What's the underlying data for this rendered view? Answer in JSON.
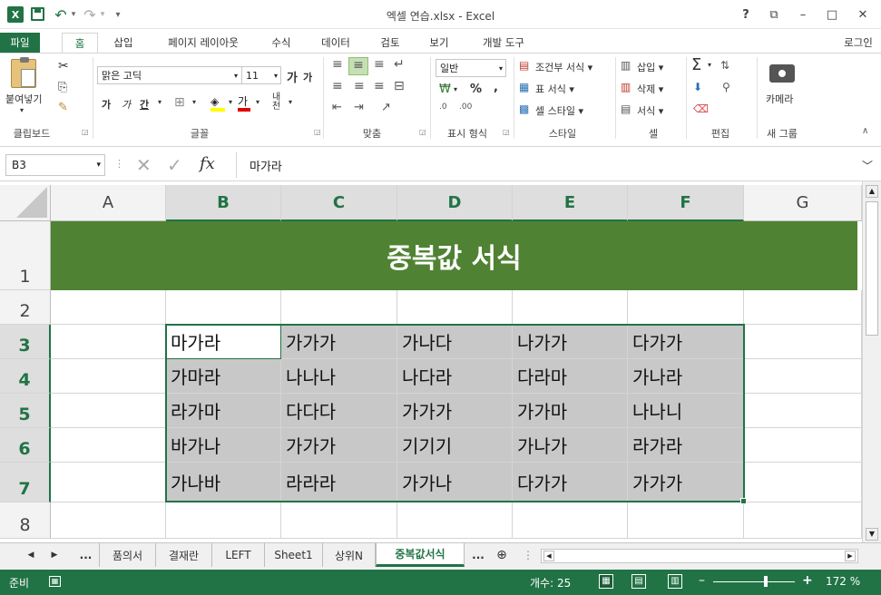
{
  "window": {
    "title": "엑셀 연습.xlsx - Excel",
    "help": "?",
    "minimize": "–",
    "maximize": "□",
    "close": "✕",
    "ribbon_display": "⧉"
  },
  "qat": {
    "undo": "↶",
    "redo": "↷",
    "customize": "▾"
  },
  "tabs": [
    {
      "label": "파일"
    },
    {
      "label": "홈"
    },
    {
      "label": "삽입"
    },
    {
      "label": "페이지 레이아웃"
    },
    {
      "label": "수식"
    },
    {
      "label": "데이터"
    },
    {
      "label": "검토"
    },
    {
      "label": "보기"
    },
    {
      "label": "개발 도구"
    }
  ],
  "signin": "로그인",
  "ribbon": {
    "clipboard": {
      "paste": "붙여넣기",
      "label": "클립보드"
    },
    "font": {
      "name": "맑은 고딕",
      "size": "11",
      "grow": "가",
      "shrink": "가",
      "bold": "가",
      "italic": "가",
      "underline": "간",
      "color_letter": "가",
      "phonetic": "내천",
      "label": "글꼴"
    },
    "align": {
      "label": "맞춤"
    },
    "number": {
      "format": "일반",
      "percent": "%",
      "comma": ",",
      "label": "표시 형식"
    },
    "styles": {
      "cond": "조건부 서식",
      "table": "표 서식",
      "cell": "셀 스타일",
      "label": "스타일"
    },
    "cells": {
      "insert": "삽입",
      "delete": "삭제",
      "format": "서식",
      "label": "셀"
    },
    "edit": {
      "sum": "Σ",
      "label": "편집"
    },
    "camera": {
      "button": "카메라",
      "label": "새 그룹"
    }
  },
  "formula_bar": {
    "name_box": "B3",
    "fx": "fx",
    "value": "마가라"
  },
  "columns": [
    "A",
    "B",
    "C",
    "D",
    "E",
    "F",
    "G"
  ],
  "rows": [
    "1",
    "2",
    "3",
    "4",
    "5",
    "6",
    "7",
    "8"
  ],
  "title_banner": "중복값 서식",
  "table": [
    [
      "마가라",
      "가가가",
      "가나다",
      "나가가",
      "다가가"
    ],
    [
      "가마라",
      "나나나",
      "나다라",
      "다라마",
      "가나라"
    ],
    [
      "라가마",
      "다다다",
      "가가가",
      "가가마",
      "나나니"
    ],
    [
      "바가나",
      "가가가",
      "기기기",
      "가나가",
      "라가라"
    ],
    [
      "가나바",
      "라라라",
      "가가나",
      "다가가",
      "가가가"
    ]
  ],
  "sheets": [
    {
      "label": "..."
    },
    {
      "label": "품의서"
    },
    {
      "label": "결재란"
    },
    {
      "label": "LEFT"
    },
    {
      "label": "Sheet1"
    },
    {
      "label": "상위N"
    },
    {
      "label": "중복값서식"
    },
    {
      "label": "..."
    }
  ],
  "status": {
    "ready": "준비",
    "count": "개수: 25",
    "zoom": "172 %"
  },
  "colors": {
    "accent": "#217346",
    "banner": "#4f8232",
    "highlight": "#c8c8c8"
  }
}
